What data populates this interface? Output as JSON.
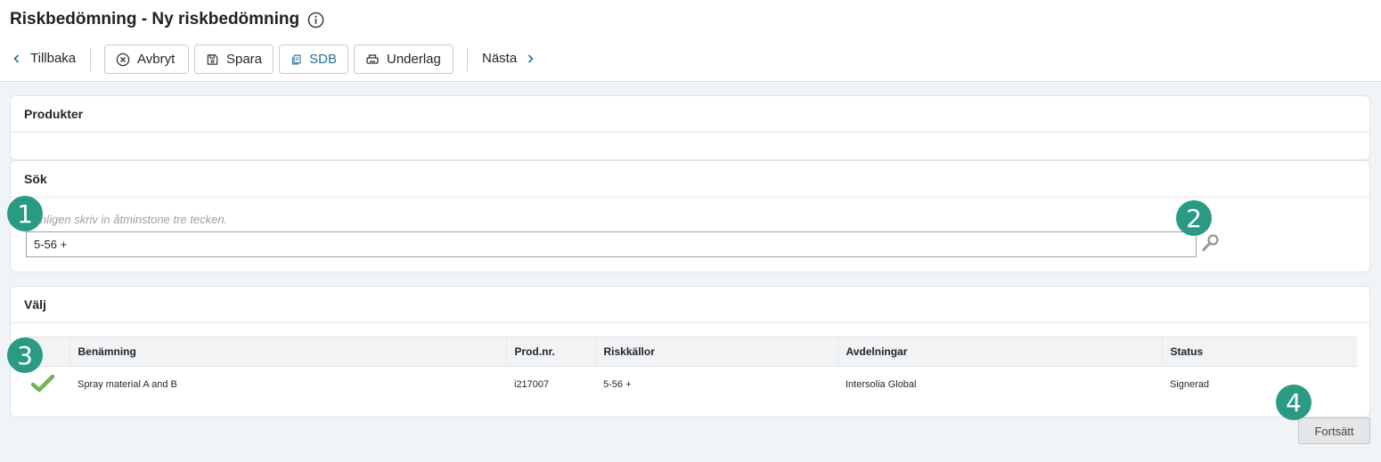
{
  "header": {
    "title": "Riskbedömning - Ny riskbedömning",
    "info_icon": "info-circle-icon"
  },
  "toolbar": {
    "back_label": "Tillbaka",
    "cancel_label": "Avbryt",
    "save_label": "Spara",
    "sdb_label": "SDB",
    "underlag_label": "Underlag",
    "next_label": "Nästa",
    "sdb_color": "#2a6f95"
  },
  "products": {
    "title": "Produkter"
  },
  "search": {
    "title": "Sök",
    "hint": "Vänligen skriv in åtminstone tre tecken.",
    "value": "5-56 +"
  },
  "select": {
    "title": "Välj",
    "columns": [
      "",
      "Benämning",
      "Prod.nr.",
      "Riskkällor",
      "Avdelningar",
      "Status"
    ],
    "rows": [
      {
        "selected": true,
        "name": "Spray material A and B",
        "prod_nr": "i217007",
        "riskkallor": "5-56 +",
        "avdelningar": "Intersolia Global",
        "status": "Signerad"
      }
    ]
  },
  "continue_label": "Fortsätt",
  "badges": [
    "1",
    "2",
    "3",
    "4"
  ],
  "badge_color": "#2a9a84"
}
